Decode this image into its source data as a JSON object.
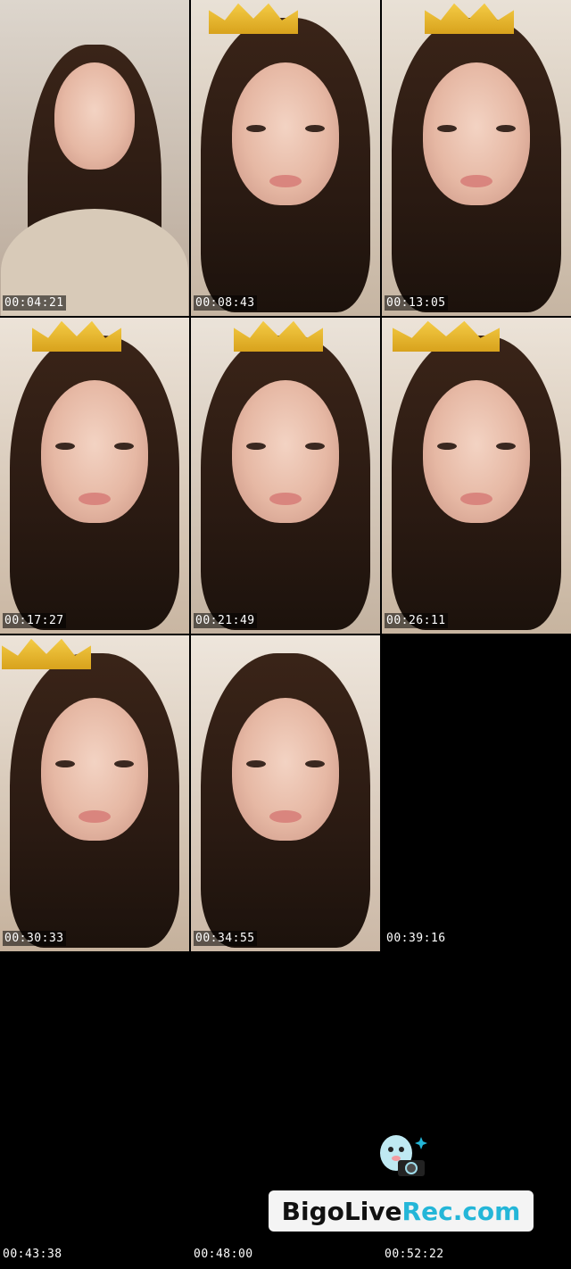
{
  "thumbnails": [
    {
      "timestamp": "00:04:21",
      "crown": false
    },
    {
      "timestamp": "00:08:43",
      "crown": true
    },
    {
      "timestamp": "00:13:05",
      "crown": true
    },
    {
      "timestamp": "00:17:27",
      "crown": true
    },
    {
      "timestamp": "00:21:49",
      "crown": true
    },
    {
      "timestamp": "00:26:11",
      "crown": true
    },
    {
      "timestamp": "00:30:33",
      "crown": true
    },
    {
      "timestamp": "00:34:55",
      "crown": false
    },
    {
      "timestamp": "00:39:16",
      "crown": false
    }
  ],
  "empty_timestamps": [
    "00:43:38",
    "00:48:00",
    "00:52:22"
  ],
  "watermark": {
    "text_part1": "BigoLive",
    "text_part2": "Rec.com",
    "icon": "camera-mascot-icon",
    "accent_color": "#24b6d8"
  }
}
